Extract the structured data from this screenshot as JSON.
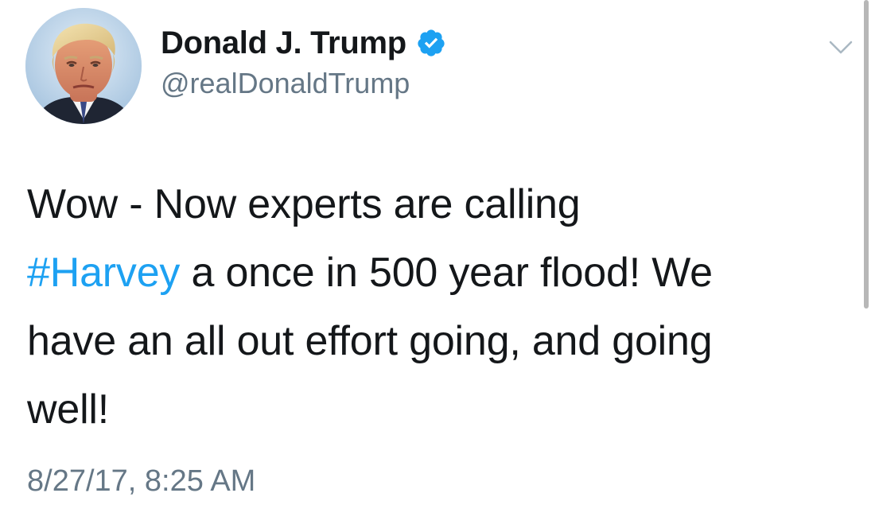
{
  "user": {
    "display_name": "Donald J. Trump",
    "handle": "@realDonaldTrump",
    "verified": true,
    "avatar_icon": "profile-photo"
  },
  "tweet": {
    "line1": "Wow - Now experts are calling",
    "hashtag": "#Harvey",
    "line2_rest": " a once in 500 year flood! We",
    "line3": "have an all out effort going, and going",
    "line4": "well!",
    "timestamp": "8/27/17, 8:25 AM"
  },
  "icons": {
    "verified": "verified-badge-icon",
    "menu": "chevron-down-icon"
  },
  "colors": {
    "text": "#14171a",
    "secondary": "#657786",
    "link": "#1da1f2",
    "verified": "#1da1f2"
  }
}
